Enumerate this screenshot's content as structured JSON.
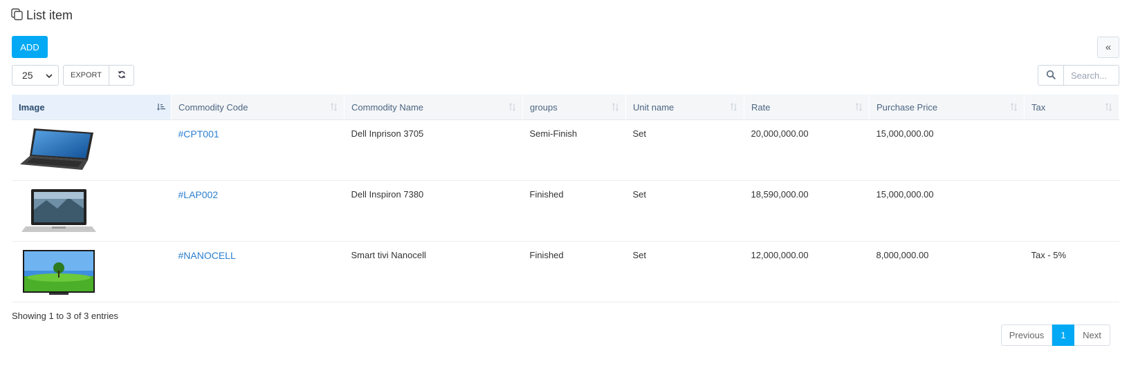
{
  "page": {
    "title": "List item",
    "title_icon": "copy-icon"
  },
  "toolbar": {
    "add_label": "ADD",
    "collapse_symbol": "«",
    "page_length": "25",
    "export_label": "EXPORT",
    "reload_icon": "refresh-icon"
  },
  "search": {
    "placeholder": "Search...",
    "icon": "search-icon"
  },
  "table": {
    "columns": [
      "Image",
      "Commodity Code",
      "Commodity Name",
      "groups",
      "Unit name",
      "Rate",
      "Purchase Price",
      "Tax"
    ],
    "sorted_column": "Image",
    "rows": [
      {
        "image": "laptop-image",
        "code": "#CPT001",
        "name": "Dell Inprison 3705",
        "group": "Semi-Finish",
        "unit": "Set",
        "rate": "20,000,000.00",
        "purchase_price": "15,000,000.00",
        "tax": ""
      },
      {
        "image": "laptop-silver-image",
        "code": "#LAP002",
        "name": "Dell Inspiron 7380",
        "group": "Finished",
        "unit": "Set",
        "rate": "18,590,000.00",
        "purchase_price": "15,000,000.00",
        "tax": ""
      },
      {
        "image": "tv-image",
        "code": "#NANOCELL",
        "name": "Smart tivi Nanocell",
        "group": "Finished",
        "unit": "Set",
        "rate": "12,000,000.00",
        "purchase_price": "8,000,000.00",
        "tax": "Tax - 5%"
      }
    ]
  },
  "footer": {
    "info": "Showing 1 to 3 of 3 entries",
    "previous_label": "Previous",
    "current_page": "1",
    "next_label": "Next"
  },
  "colors": {
    "accent": "#03a9f4",
    "link": "#2b7fcf",
    "header_bg": "#f4f6f8"
  }
}
